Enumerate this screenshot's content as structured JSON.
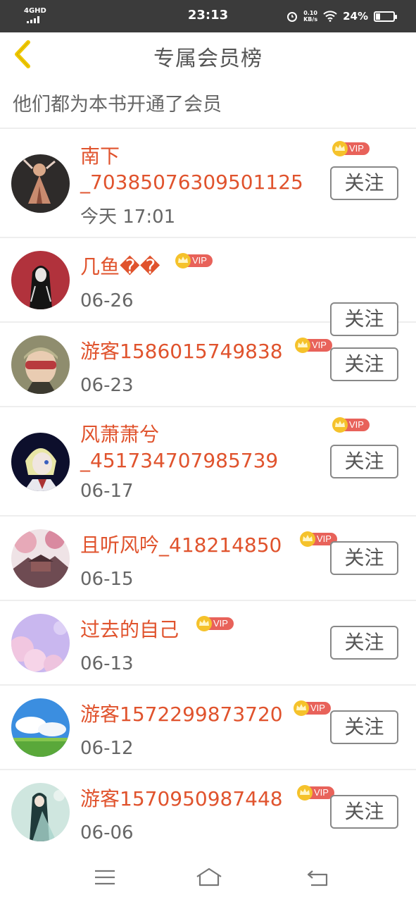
{
  "status_bar": {
    "network": "4GHD",
    "time": "23:13",
    "speed_value": "0.10",
    "speed_unit": "KB/s",
    "battery": "24%",
    "battery_level": 0.24
  },
  "header": {
    "title": "专属会员榜",
    "subtitle": "他们都为本书开通了会员"
  },
  "follow_label": "关注",
  "vip_label": "VIP",
  "members": [
    {
      "name_line1": "南下",
      "name_line2": "_70385076309501125",
      "date": "今天 17:01"
    },
    {
      "name_line1": "几鱼��",
      "name_line2": "",
      "date": "06-26"
    },
    {
      "name_line1": "游客1586015749838",
      "name_line2": "",
      "date": "06-23"
    },
    {
      "name_line1": "风萧萧兮",
      "name_line2": "_451734707985739",
      "date": "06-17"
    },
    {
      "name_line1": "且听风吟_418214850",
      "name_line2": "",
      "date": "06-15"
    },
    {
      "name_line1": "过去的自己",
      "name_line2": "",
      "date": "06-13"
    },
    {
      "name_line1": "游客1572299873720",
      "name_line2": "",
      "date": "06-12"
    },
    {
      "name_line1": "游客1570950987448",
      "name_line2": "",
      "date": "06-06"
    }
  ],
  "colors": {
    "name": "#e0532d",
    "vip_badge": "#e8625a",
    "crown": "#f5c22b",
    "back_arrow": "#f0c800"
  },
  "icons": {
    "back": "chevron-left-icon",
    "vip": "crown-vip-icon",
    "menu": "menu-icon",
    "home": "home-icon",
    "return": "return-icon"
  }
}
